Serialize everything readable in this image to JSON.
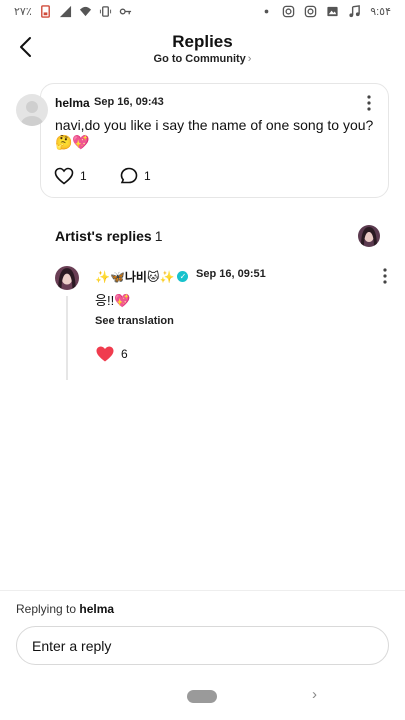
{
  "status_bar": {
    "battery": "٢٧٪",
    "time": "٩:٥۴",
    "left_icons": [
      "battery-low-icon",
      "signal-icon",
      "wifi-icon",
      "vibrate-icon",
      "key-icon"
    ],
    "right_icons": [
      "notification-dot-icon",
      "instagram-icon",
      "instagram-icon",
      "gallery-icon",
      "music-note-icon"
    ]
  },
  "header": {
    "title": "Replies",
    "community_link": "Go to Community"
  },
  "comment": {
    "author": "helma",
    "time": "Sep 16, 09:43",
    "text": "navi,do you like i say the name of one song to you?",
    "emoji": "🤔💖",
    "like_count": "1",
    "reply_count": "1"
  },
  "artist_replies": {
    "title": "Artist's replies",
    "count": "1",
    "reply": {
      "author": "✨🦋나비🐱✨",
      "time": "Sep 16, 09:51",
      "text": "응!!💖",
      "see_translation": "See translation",
      "like_count": "6"
    }
  },
  "footer": {
    "replying_prefix": "Replying to",
    "replying_user": "helma",
    "input_placeholder": "Enter a reply"
  },
  "colors": {
    "accent_heart": "#f03c4e",
    "verified": "#17c2cc",
    "border": "#e6e6e6"
  }
}
